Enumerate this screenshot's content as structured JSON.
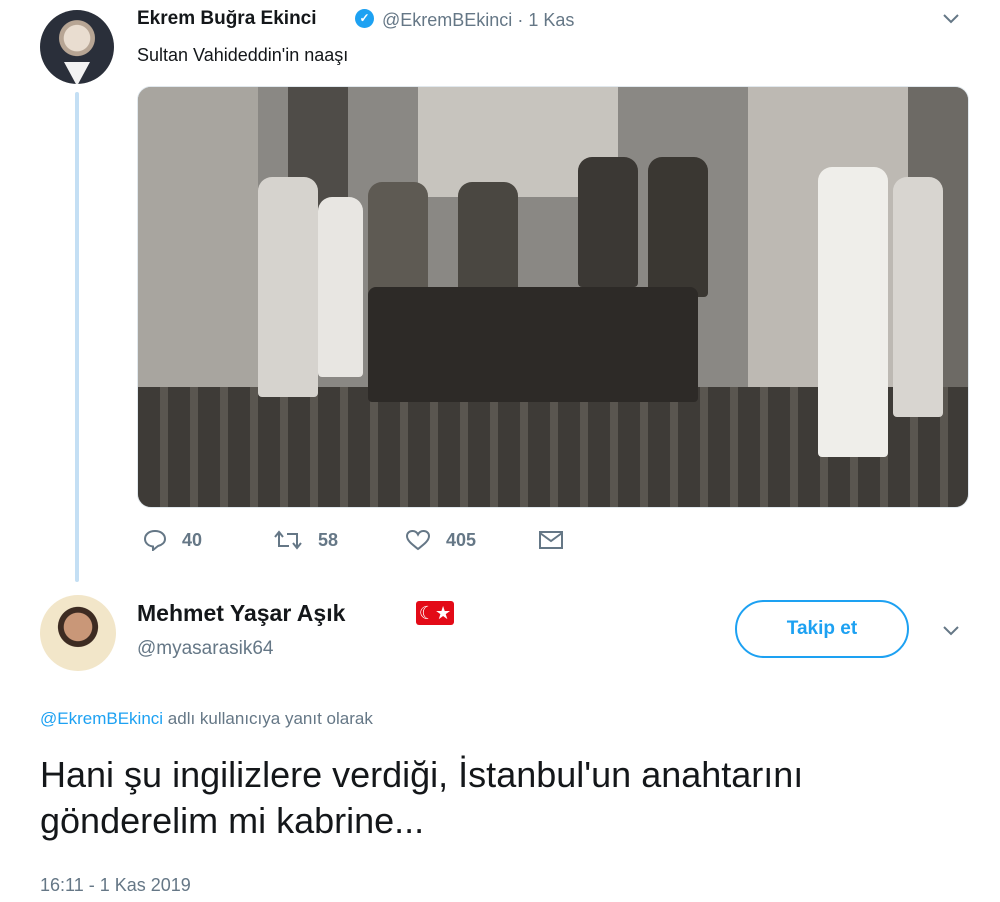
{
  "tweet": {
    "author_name": "Ekrem Buğra Ekinci",
    "author_handle": "@EkremBEkinci",
    "date_separator": "·",
    "date": "1 Kas",
    "text": "Sultan Vahideddin'in naaşı",
    "stats": {
      "replies": "40",
      "retweets": "58",
      "likes": "405"
    }
  },
  "reply": {
    "author_name": "Mehmet Yaşar Aşık",
    "author_handle": "@myasarasik64",
    "follow_label": "Takip et",
    "replying_to_handle": "@EkremBEkinci",
    "replying_to_suffix": " adlı kullanıcıya yanıt olarak",
    "text": "Hani şu ingilizlere verdiği, İstanbul'un anahtarını gönderelim mi kabrine...",
    "timestamp": "16:11 - 1 Kas 2019"
  },
  "colors": {
    "accent": "#1da1f2",
    "muted": "#657786",
    "thread": "#c4dff4",
    "flag": "#e30a17"
  },
  "icons": [
    "verified-badge-icon",
    "chevron-down-icon",
    "reply-icon",
    "retweet-icon",
    "like-icon",
    "message-icon",
    "turkish-flag-icon"
  ]
}
